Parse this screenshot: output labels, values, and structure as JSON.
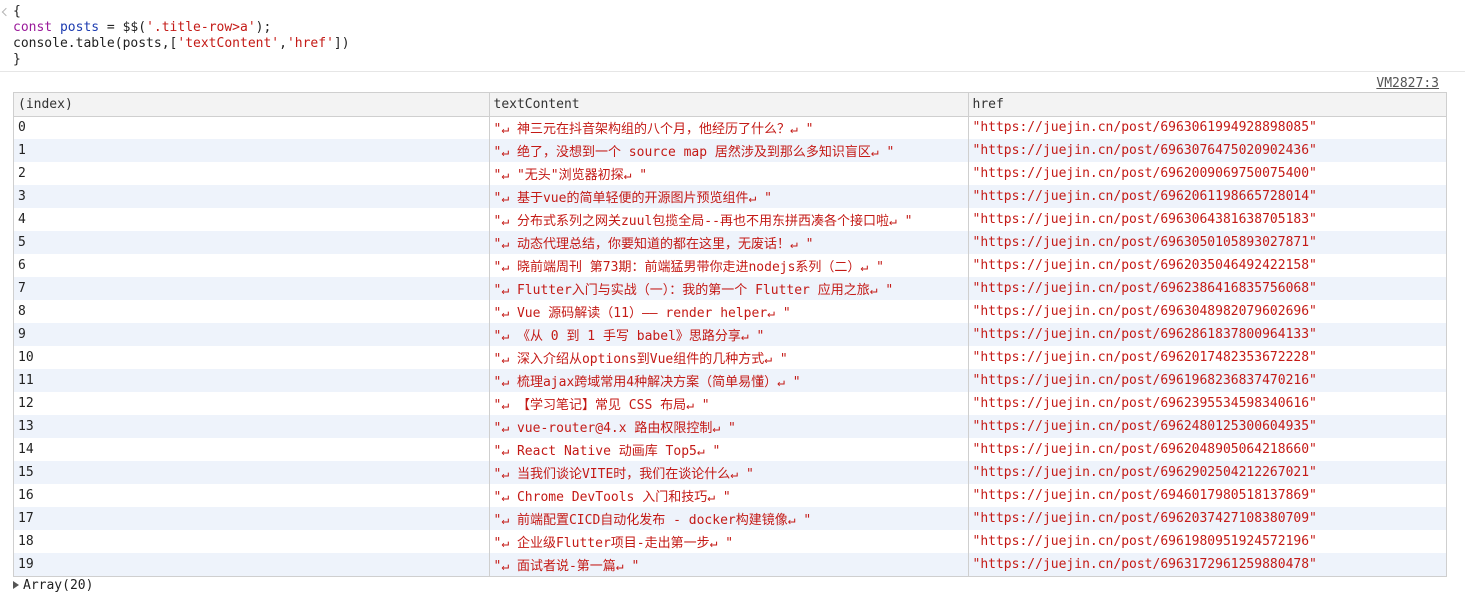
{
  "code": {
    "open_brace": "{",
    "kw_const": "const",
    "var_posts": "posts",
    "assign": " = $$(",
    "selector": "'.title-row>a'",
    "end_assign": ");",
    "console_table": "console.table(posts,[",
    "col_text": "'textContent'",
    "comma": ",",
    "col_href": "'href'",
    "end_call": "])",
    "close_brace": "}"
  },
  "source_link": "VM2827:3",
  "table": {
    "headers": [
      "(index)",
      "textContent",
      "href"
    ],
    "rows": [
      {
        "index": "0",
        "text": "\"↵ 神三元在抖音架构组的八个月，他经历了什么？↵ \"",
        "href": "\"https://juejin.cn/post/6963061994928898085\""
      },
      {
        "index": "1",
        "text": "\"↵ 绝了，没想到一个 source map 居然涉及到那么多知识盲区↵ \"",
        "href": "\"https://juejin.cn/post/6963076475020902436\""
      },
      {
        "index": "2",
        "text": "\"↵ \"无头\"浏览器初探↵ \"",
        "href": "\"https://juejin.cn/post/6962009069750075400\""
      },
      {
        "index": "3",
        "text": "\"↵ 基于vue的简单轻便的开源图片预览组件↵ \"",
        "href": "\"https://juejin.cn/post/6962061198665728014\""
      },
      {
        "index": "4",
        "text": "\"↵ 分布式系列之网关zuul包揽全局--再也不用东拼西凑各个接口啦↵ \"",
        "href": "\"https://juejin.cn/post/6963064381638705183\""
      },
      {
        "index": "5",
        "text": "\"↵ 动态代理总结，你要知道的都在这里，无废话！↵ \"",
        "href": "\"https://juejin.cn/post/6963050105893027871\""
      },
      {
        "index": "6",
        "text": "\"↵ 晓前端周刊 第73期：前端猛男带你走进nodejs系列（二）↵ \"",
        "href": "\"https://juejin.cn/post/6962035046492422158\""
      },
      {
        "index": "7",
        "text": "\"↵ Flutter入门与实战（一）：我的第一个 Flutter 应用之旅↵ \"",
        "href": "\"https://juejin.cn/post/6962386416835756068\""
      },
      {
        "index": "8",
        "text": "\"↵ Vue 源码解读（11）—— render helper↵ \"",
        "href": "\"https://juejin.cn/post/6963048982079602696\""
      },
      {
        "index": "9",
        "text": "\"↵ 《从 0 到 1 手写 babel》思路分享↵ \"",
        "href": "\"https://juejin.cn/post/6962861837800964133\""
      },
      {
        "index": "10",
        "text": "\"↵ 深入介绍从options到Vue组件的几种方式↵ \"",
        "href": "\"https://juejin.cn/post/6962017482353672228\""
      },
      {
        "index": "11",
        "text": "\"↵ 梳理ajax跨域常用4种解决方案（简单易懂）↵ \"",
        "href": "\"https://juejin.cn/post/6961968236837470216\""
      },
      {
        "index": "12",
        "text": "\"↵ 【学习笔记】常见 CSS 布局↵ \"",
        "href": "\"https://juejin.cn/post/6962395534598340616\""
      },
      {
        "index": "13",
        "text": "\"↵ vue-router@4.x 路由权限控制↵ \"",
        "href": "\"https://juejin.cn/post/6962480125300604935\""
      },
      {
        "index": "14",
        "text": "\"↵ React Native 动画库 Top5↵ \"",
        "href": "\"https://juejin.cn/post/6962048905064218660\""
      },
      {
        "index": "15",
        "text": "\"↵ 当我们谈论VITE时，我们在谈论什么↵ \"",
        "href": "\"https://juejin.cn/post/6962902504212267021\""
      },
      {
        "index": "16",
        "text": "\"↵ Chrome DevTools 入门和技巧↵ \"",
        "href": "\"https://juejin.cn/post/6946017980518137869\""
      },
      {
        "index": "17",
        "text": "\"↵ 前端配置CICD自动化发布 - docker构建镜像↵ \"",
        "href": "\"https://juejin.cn/post/6962037427108380709\""
      },
      {
        "index": "18",
        "text": "\"↵ 企业级Flutter项目-走出第一步↵ \"",
        "href": "\"https://juejin.cn/post/6961980951924572196\""
      },
      {
        "index": "19",
        "text": "\"↵ 面试者说-第一篇↵ \"",
        "href": "\"https://juejin.cn/post/6963172961259880478\""
      }
    ]
  },
  "footer": {
    "array_label": "Array(20)"
  },
  "colors": {
    "string_red": "#c41a16",
    "keyword_purple": "#9a1a9a",
    "variable_blue": "#1c3bb0",
    "row_stripe": "#eef3fb",
    "header_bg": "#f3f3f3"
  },
  "icons": {
    "code_chevron": "chevron-right-icon",
    "expand_triangle": "triangle-right-icon"
  }
}
